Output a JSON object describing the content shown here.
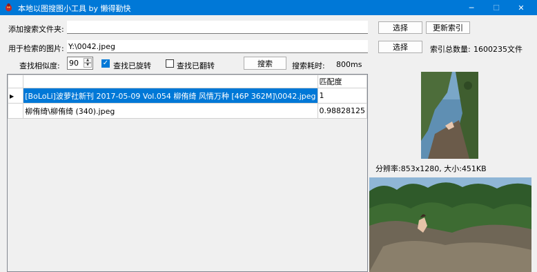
{
  "window": {
    "title": "本地以图搜图小工具 by 懒得勤快",
    "icon": "bug-icon",
    "accent": "#0078d7",
    "minimize": "─",
    "maximize": "☐",
    "close": "✕"
  },
  "form": {
    "folder_label": "添加搜索文件夹:",
    "folder_value": "",
    "image_label": "用于检索的图片:",
    "image_value": "Y:\\0042.jpeg",
    "similarity_label": "查找相似度:",
    "similarity_value": "90",
    "find_rotated_label": "查找已旋转",
    "find_rotated_checked": true,
    "find_flipped_label": "查找已翻转",
    "find_flipped_checked": false,
    "search_button": "搜索",
    "elapsed_label": "搜索耗时:",
    "elapsed_value": "800ms",
    "select_button_1": "选择",
    "update_index_button": "更新索引",
    "select_button_2": "选择",
    "index_count_label": "索引总数量:",
    "index_count_value": "1600235文件"
  },
  "results": {
    "columns": [
      "",
      "匹配度"
    ],
    "rows": [
      {
        "path": "[BoLoLi]波萝社新刊 2017-05-09 Vol.054 柳侑绮 风情万种 [46P 362M]\\0042.jpeg",
        "score": "1",
        "selected": true
      },
      {
        "path": "柳侑绮\\柳侑绮 (340).jpeg",
        "score": "0.98828125",
        "selected": false
      }
    ]
  },
  "preview": {
    "resolution_label": "分辨率:",
    "resolution_value": "853x1280",
    "size_label": "大小:",
    "size_value": "451KB",
    "separator": ", "
  }
}
